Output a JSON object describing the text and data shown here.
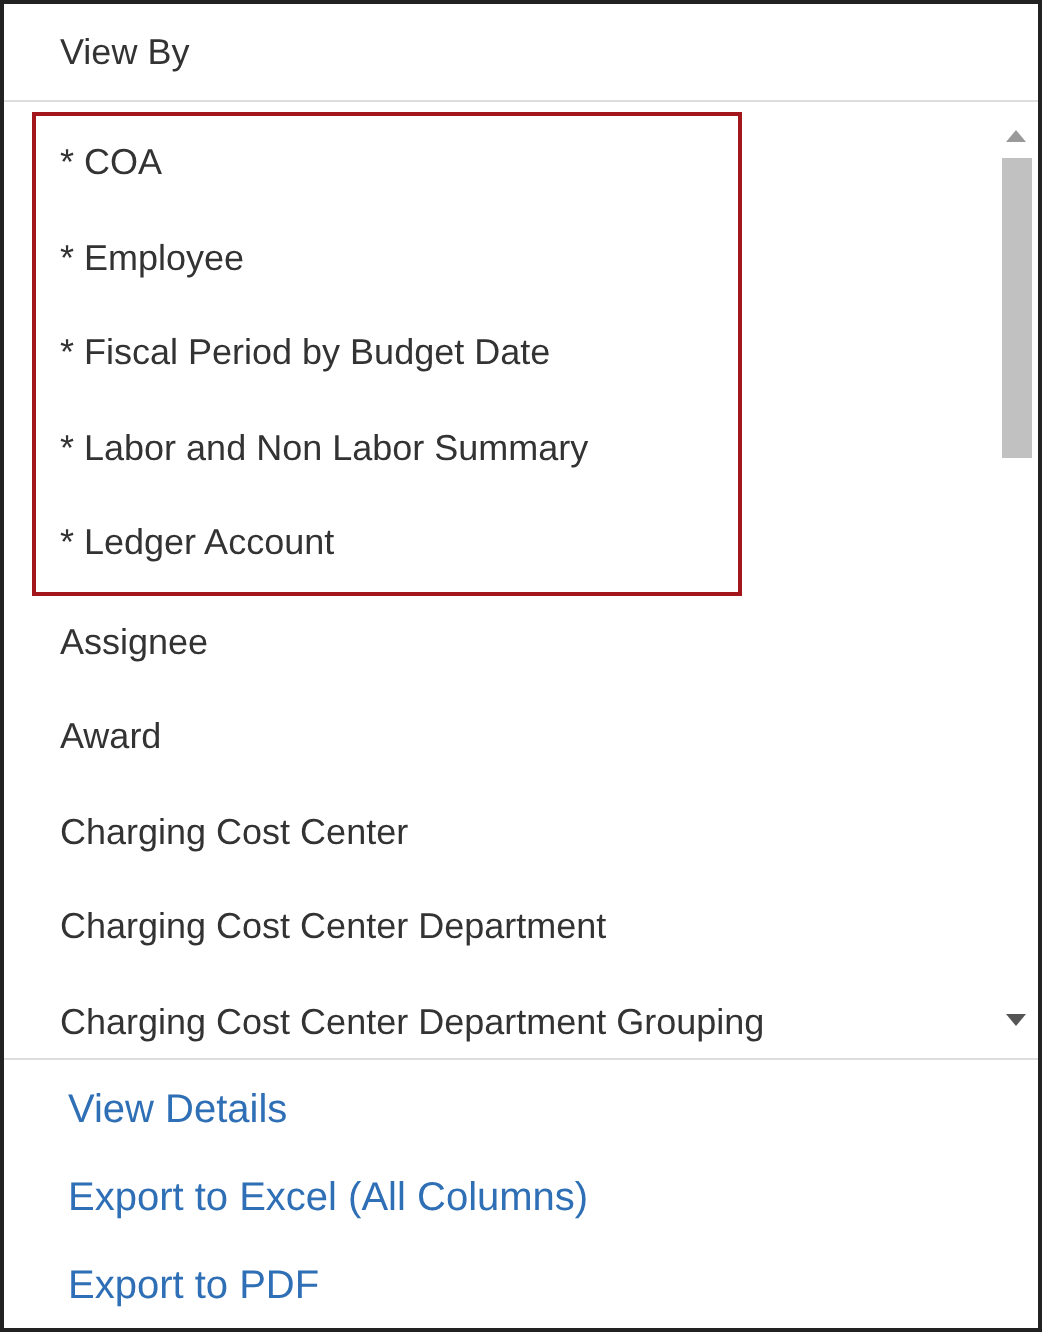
{
  "header": {
    "title": "View By"
  },
  "groups": [
    {
      "highlighted": true,
      "items": [
        "* COA",
        "* Employee",
        "* Fiscal Period by Budget Date",
        "* Labor and Non Labor Summary",
        "* Ledger Account"
      ]
    },
    {
      "highlighted": false,
      "items": [
        "Assignee",
        "Award",
        "Charging Cost Center",
        "Charging Cost Center Department",
        "Charging Cost Center Department Grouping"
      ]
    }
  ],
  "actions": [
    "View Details",
    "Export to Excel (All Columns)",
    "Export to PDF"
  ]
}
